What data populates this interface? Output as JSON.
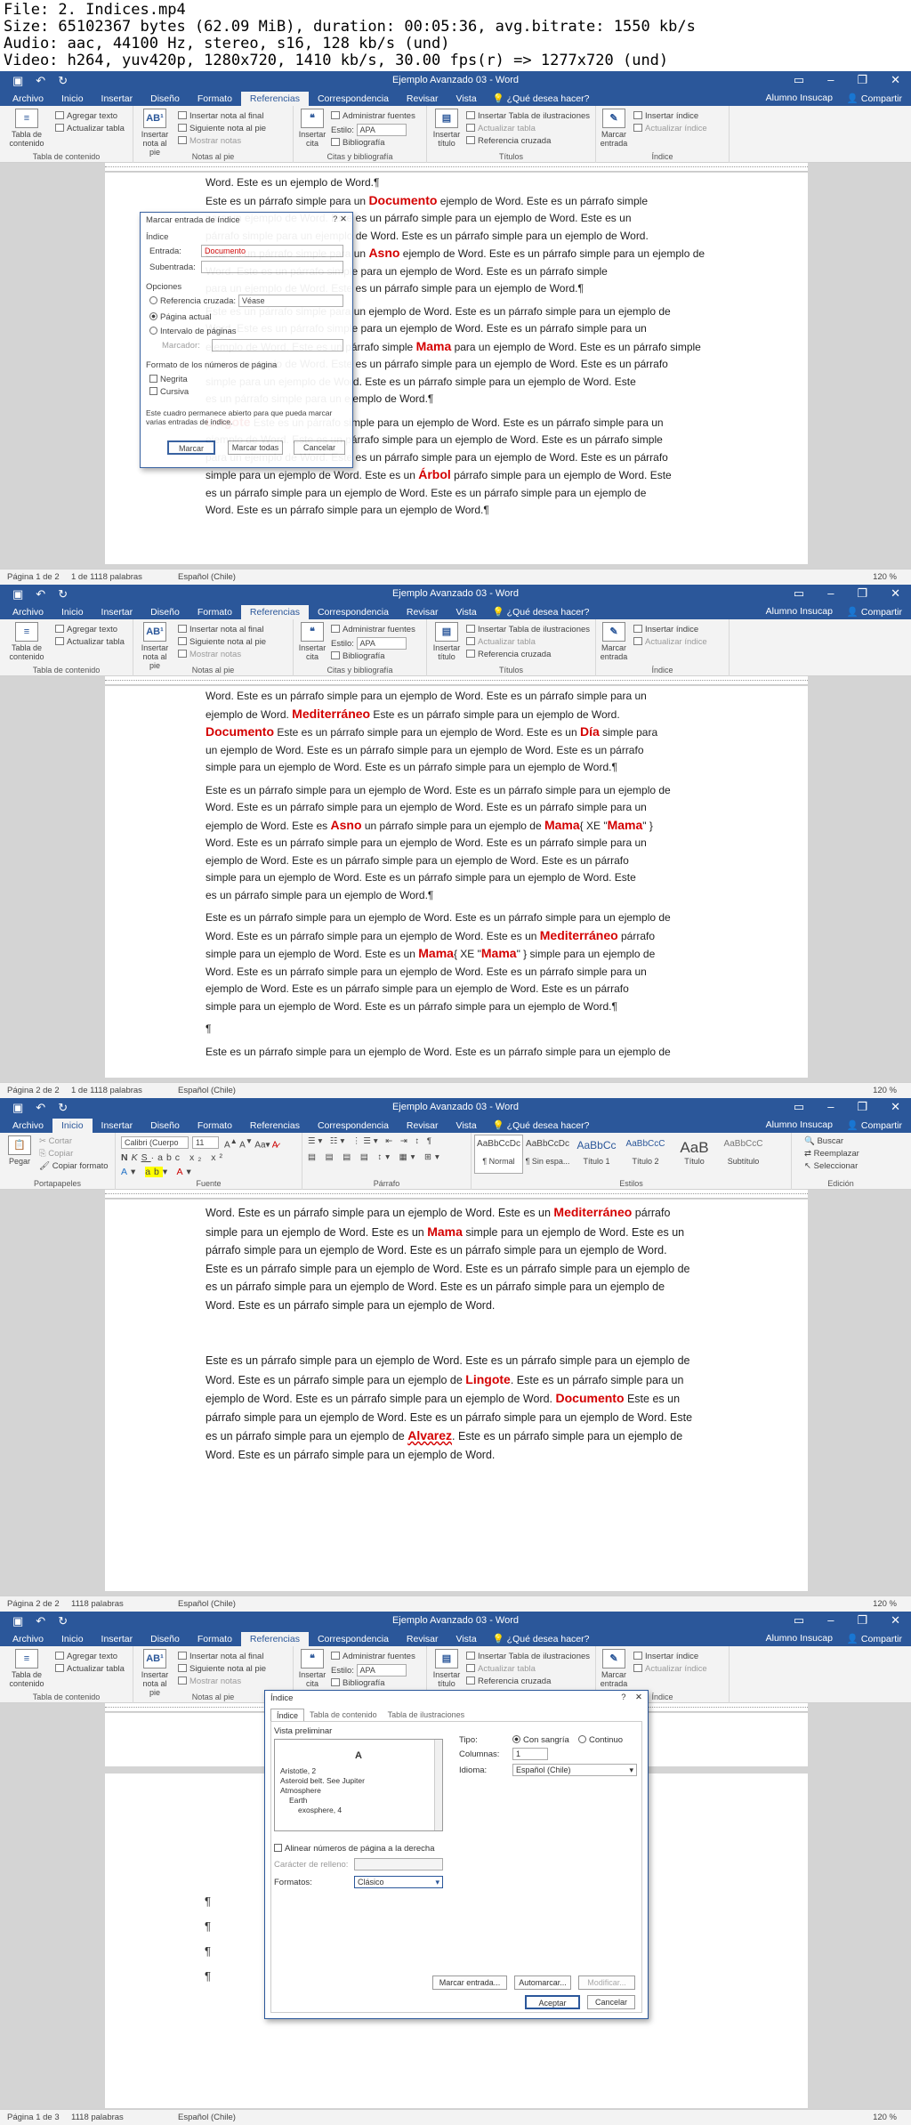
{
  "header": {
    "lines": [
      "File: 2. Indices.mp4",
      "Size: 65102367 bytes (62.09 MiB), duration: 00:05:36, avg.bitrate: 1550 kb/s",
      "Audio: aac, 44100 Hz, stereo, s16, 128 kb/s (und)",
      "Video: h264, yuv420p, 1280x720, 1410 kb/s, 30.00 fps(r) => 1277x720 (und)"
    ]
  },
  "common": {
    "window_title": "Ejemplo Avanzado 03 - Word",
    "tabs": [
      "Archivo",
      "Inicio",
      "Insertar",
      "Diseño",
      "Formato",
      "Referencias",
      "Correspondencia",
      "Revisar",
      "Vista"
    ],
    "tell_me": "¿Qué desea hacer?",
    "user": "Alumno Insucap",
    "share": "Compartir",
    "language": "Español (Chile)",
    "zoom": "120 %",
    "colors": {
      "titlebar": "#2b579a",
      "keyword": "#d40000"
    }
  },
  "ref_ribbon": {
    "toc_button": "Tabla de contenido",
    "add_text": "Agregar texto",
    "update_table": "Actualizar tabla",
    "toc_group": "Tabla de contenido",
    "insert_footnote": "Insertar nota al pie",
    "insert_endnote": "Insertar nota al final",
    "next_footnote": "Siguiente nota al pie",
    "show_notes": "Mostrar notas",
    "notes_group": "Notas al pie",
    "insert_citation": "Insertar cita",
    "manage_sources": "Administrar fuentes",
    "style_label": "Estilo:",
    "style_value": "APA",
    "bibliography": "Bibliografía",
    "citations_group": "Citas y bibliografía",
    "insert_caption": "Insertar título",
    "insert_table_fig": "Insertar Tabla de ilustraciones",
    "update_table_fig": "Actualizar tabla",
    "cross_ref": "Referencia cruzada",
    "captions_group": "Títulos",
    "mark_entry": "Marcar entrada",
    "insert_index": "Insertar índice",
    "update_index": "Actualizar índice",
    "index_group": "Índice"
  },
  "home_ribbon": {
    "paste": "Pegar",
    "cut": "Cortar",
    "copy": "Copiar",
    "format_painter": "Copiar formato",
    "clipboard_group": "Portapapeles",
    "font_name": "Calibri (Cuerpo",
    "font_size": "11",
    "font_group": "Fuente",
    "paragraph_group": "Párrafo",
    "styles": [
      {
        "preview": "AaBbCcDc",
        "name": "¶ Normal"
      },
      {
        "preview": "AaBbCcDc",
        "name": "¶ Sin espa..."
      },
      {
        "preview": "AaBbCc",
        "name": "Título 1"
      },
      {
        "preview": "AaBbCcC",
        "name": "Título 2"
      },
      {
        "preview": "AaB",
        "name": "Título"
      },
      {
        "preview": "AaBbCcC",
        "name": "Subtítulo"
      }
    ],
    "styles_group": "Estilos",
    "find": "Buscar",
    "replace": "Reemplazar",
    "select": "Seleccionar",
    "editing_group": "Edición"
  },
  "frame1": {
    "status_page": "Página 1 de 2",
    "status_words": "1 de 1118 palabras",
    "lines": [
      "Word. Este es un ejemplo de Word.¶",
      "Este es un párrafo simple para un [Documento] ejemplo de Word. Este es un párrafo simple",
      "para un ejemplo de Word. Este es un párrafo simple para un ejemplo de Word. Este es un",
      "párrafo simple para un ejemplo de Word. Este es un párrafo simple para un ejemplo de Word.",
      "Este es un párrafo simple para un [Asno] ejemplo de Word. Este es un párrafo simple para un ejemplo de",
      "Word. Este es un párrafo simple para un ejemplo de Word. Este es un párrafo simple",
      "para un ejemplo de Word. Este es un párrafo simple para un ejemplo de Word.¶",
      "",
      "Este es un párrafo simple para un ejemplo de Word. Este es un párrafo simple para un ejemplo de",
      "Word. Este es un párrafo simple para un ejemplo de Word. Este es un párrafo simple para un",
      "ejemplo de Word. Este es un párrafo simple [Mama] para un ejemplo de Word. Este es un párrafo simple",
      "para un ejemplo de Word. Este es un párrafo simple para un ejemplo de Word. Este es un párrafo",
      "simple para un ejemplo de Word. Este es un párrafo simple para un ejemplo de Word. Este",
      "es un párrafo simple para un ejemplo de Word.¶",
      "",
      "[Lingote] Este es un párrafo simple para un ejemplo de Word. Este es un párrafo simple para un",
      "ejemplo de Word. Este es un párrafo simple para un ejemplo de Word. Este es un párrafo simple",
      "para un ejemplo de Word. Este es un párrafo simple para un ejemplo de Word. Este es un párrafo",
      "simple para un ejemplo de Word. Este es un [Árbol] párrafo simple para un ejemplo de Word. Este",
      "es un párrafo simple para un ejemplo de Word. Este es un párrafo simple para un ejemplo de",
      "Word. Este es un párrafo simple para un ejemplo de Word.¶"
    ],
    "dialog": {
      "title": "Marcar entrada de índice",
      "section_index": "Índice",
      "entry_label": "Entrada:",
      "entry_value": "Documento",
      "subentry_label": "Subentrada:",
      "options": "Opciones",
      "cross_ref": "Referencia cruzada:",
      "cross_ref_value": "Véase",
      "current_page": "Página actual",
      "page_range": "Intervalo de páginas",
      "bookmark": "Marcador:",
      "page_format": "Formato de los números de página",
      "bold": "Negrita",
      "italic": "Cursiva",
      "note": "Este cuadro permanece abierto para que pueda marcar varias entradas de índice.",
      "mark": "Marcar",
      "mark_all": "Marcar todas",
      "cancel": "Cancelar"
    }
  },
  "frame2": {
    "status_page": "Página 2 de 2",
    "status_words": "1 de 1118 palabras",
    "lines": [
      "Word. Este es un párrafo simple para un ejemplo de Word. Este es un párrafo simple para un",
      "ejemplo de Word. [Mediterráneo] Este es un párrafo simple para un ejemplo de Word.",
      "[Documento] Este es un párrafo simple para un ejemplo de Word. Este es un [Día] simple para",
      "un ejemplo de Word. Este es un párrafo simple para un ejemplo de Word. Este es un párrafo",
      "simple para un ejemplo de Word. Este es un párrafo simple para un ejemplo de Word.¶",
      "",
      "Este es un párrafo simple para un ejemplo de Word. Este es un párrafo simple para un ejemplo de",
      "Word. Este es un párrafo simple para un ejemplo de Word. Este es un párrafo simple para un",
      "ejemplo de Word. Este es [Asno] un párrafo simple para un ejemplo de [Mama]{ XE \"Mama\" }",
      "Word. Este es un párrafo simple para un ejemplo de Word. Este es un párrafo simple para un",
      "ejemplo de Word. Este es un párrafo simple para un ejemplo de Word. Este es un párrafo",
      "simple para un ejemplo de Word. Este es un párrafo simple para un ejemplo de Word. Este",
      "es un párrafo simple para un ejemplo de Word.¶",
      "",
      "Este es un párrafo simple para un ejemplo de Word. Este es un párrafo simple para un ejemplo de",
      "Word. Este es un párrafo simple para un ejemplo de Word. Este es un [Mediterráneo] párrafo",
      "simple para un ejemplo de Word. Este es un [Mama]{ XE \"Mama\" } simple para un ejemplo de",
      "Word. Este es un párrafo simple para un ejemplo de Word. Este es un párrafo simple para un",
      "ejemplo de Word. Este es un párrafo simple para un ejemplo de Word. Este es un párrafo",
      "simple para un ejemplo de Word. Este es un párrafo simple para un ejemplo de Word.¶",
      "",
      "¶",
      "",
      "Este es un párrafo simple para un ejemplo de Word. Este es un párrafo simple para un ejemplo de"
    ]
  },
  "frame3": {
    "status_page": "Página 2 de 2",
    "status_words": "1118 palabras",
    "lines": [
      "Word. Este es un párrafo simple para un ejemplo de Word. Este es un [Mediterráneo] párrafo",
      "simple para un ejemplo de Word. Este es un [Mama] simple para un ejemplo de Word. Este es un",
      "párrafo simple para un ejemplo de Word. Este es un párrafo simple para un ejemplo de Word.",
      "Este es un párrafo simple para un ejemplo de Word. Este es un párrafo simple para un ejemplo de",
      "es un párrafo simple para un ejemplo de Word. Este es un párrafo simple para un ejemplo de",
      "Word. Este es un párrafo simple para un ejemplo de Word.",
      "",
      "",
      "Este es un párrafo simple para un ejemplo de Word. Este es un párrafo simple para un ejemplo de",
      "Word. Este es un párrafo simple para un ejemplo de [Lingote]. Este es un párrafo simple para un",
      "ejemplo de Word. Este es un párrafo simple para un ejemplo de Word. [Documento] Este es un",
      "párrafo simple para un ejemplo de Word. Este es un párrafo simple para un ejemplo de Word. Este",
      "es un párrafo simple para un ejemplo de [Alvarez]. Este es un párrafo simple para un ejemplo de",
      "Word. Este es un párrafo simple para un ejemplo de Word."
    ]
  },
  "frame4": {
    "status_page": "Página 1 de 3",
    "status_words": "1118 palabras",
    "para_marks": [
      "¶",
      "¶",
      "¶",
      "¶"
    ],
    "dialog": {
      "title": "Índice",
      "tabs": [
        "Índice",
        "Tabla de contenido",
        "Tabla de ilustraciones"
      ],
      "preview_label": "Vista preliminar",
      "preview_lines": [
        "A",
        "Aristotle, 2",
        "Asteroid belt. See Jupiter",
        "Atmosphere",
        "Earth",
        "exosphere, 4"
      ],
      "type_label": "Tipo:",
      "indented": "Con sangría",
      "run_in": "Continuo",
      "columns_label": "Columnas:",
      "columns_value": "1",
      "language_label": "Idioma:",
      "language_value": "Español (Chile)",
      "right_align": "Alinear números de página a la derecha",
      "tab_leader": "Carácter de relleno:",
      "formats_label": "Formatos:",
      "formats_value": "Clásico",
      "mark_entry": "Marcar entrada...",
      "automark": "Automarcar...",
      "modify": "Modificar...",
      "ok": "Aceptar",
      "cancel": "Cancelar"
    }
  }
}
